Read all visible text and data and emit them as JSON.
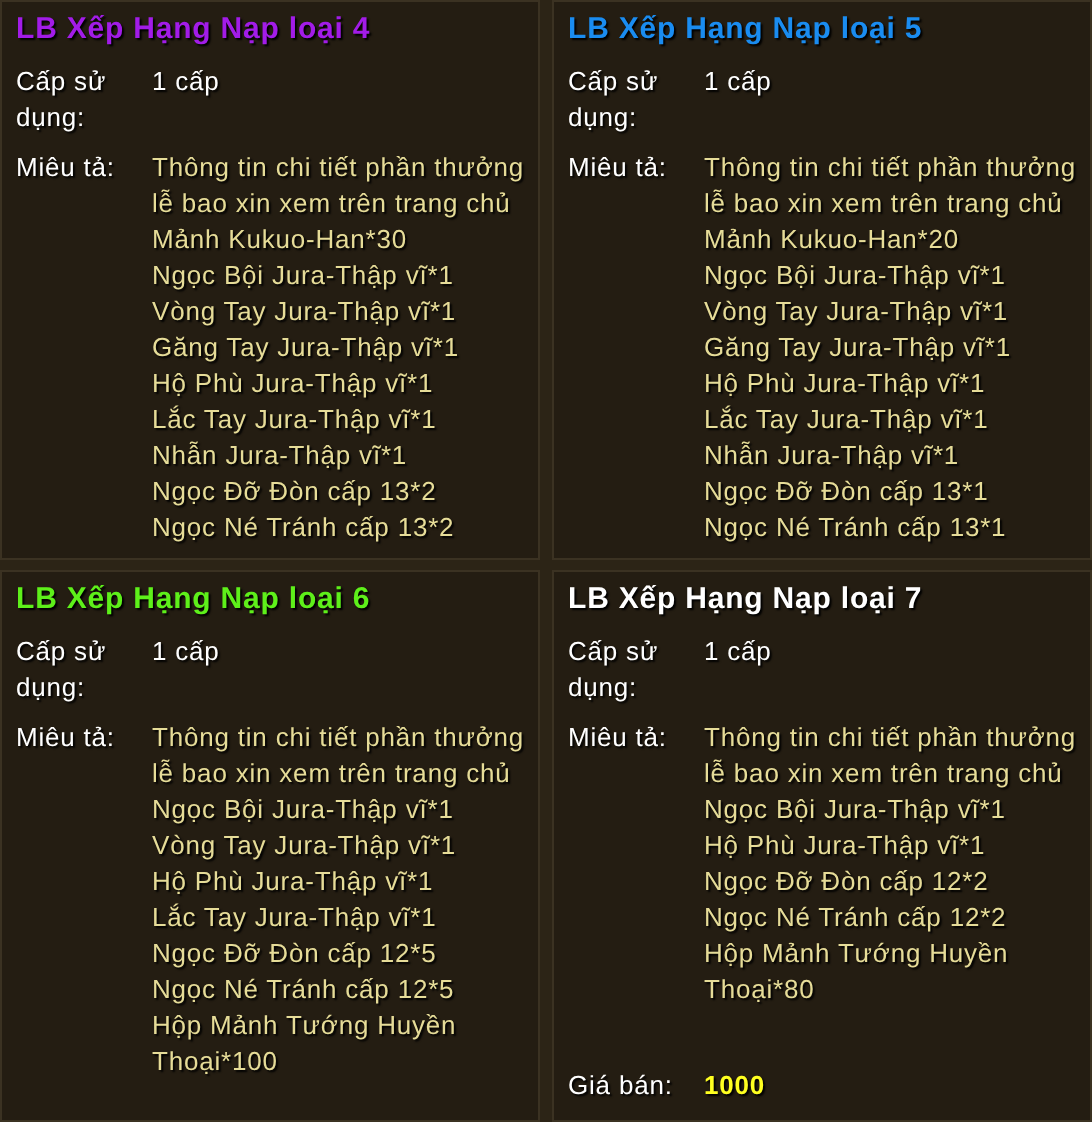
{
  "tooltips": [
    {
      "title": "LB Xếp Hạng Nạp loại 4",
      "color": "#a21ce8",
      "level_label": "Cấp sử dụng:",
      "level_value": "1 cấp",
      "desc_label": "Miêu tả:",
      "desc_lines": [
        "Thông tin chi tiết phần thưởng lễ bao xin xem trên trang chủ",
        "Mảnh Kukuo-Han*30",
        "Ngọc Bội Jura-Thập vĩ*1",
        "Vòng Tay Jura-Thập vĩ*1",
        "Găng Tay Jura-Thập vĩ*1",
        "Hộ Phù Jura-Thập vĩ*1",
        "Lắc Tay Jura-Thập vĩ*1",
        "Nhẫn Jura-Thập vĩ*1",
        "Ngọc Đỡ Đòn cấp 13*2",
        "Ngọc Né Tránh cấp 13*2"
      ]
    },
    {
      "title": "LB Xếp Hạng Nạp loại 5",
      "color": "#1a8cf0",
      "level_label": "Cấp sử dụng:",
      "level_value": "1 cấp",
      "desc_label": "Miêu tả:",
      "desc_lines": [
        "Thông tin chi tiết phần thưởng lễ bao xin xem trên trang chủ",
        "Mảnh Kukuo-Han*20",
        "Ngọc Bội Jura-Thập vĩ*1",
        "Vòng Tay Jura-Thập vĩ*1",
        "Găng Tay Jura-Thập vĩ*1",
        "Hộ Phù Jura-Thập vĩ*1",
        "Lắc Tay Jura-Thập vĩ*1",
        "Nhẫn Jura-Thập vĩ*1",
        "Ngọc Đỡ Đòn cấp 13*1",
        "Ngọc Né Tránh cấp 13*1"
      ]
    },
    {
      "title": "LB Xếp Hạng Nạp loại 6",
      "color": "#5ef01a",
      "level_label": "Cấp sử dụng:",
      "level_value": "1 cấp",
      "desc_label": "Miêu tả:",
      "desc_lines": [
        "Thông tin chi tiết phần thưởng lễ bao xin xem trên trang chủ",
        "Ngọc Bội Jura-Thập vĩ*1",
        "Vòng Tay Jura-Thập vĩ*1",
        "Hộ Phù Jura-Thập vĩ*1",
        "Lắc Tay Jura-Thập vĩ*1",
        "Ngọc Đỡ Đòn cấp 12*5",
        "Ngọc Né Tránh cấp 12*5",
        "Hộp Mảnh Tướng Huyền Thoại*100"
      ]
    },
    {
      "title": "LB Xếp Hạng Nạp loại 7",
      "color": "#ffffff",
      "level_label": "Cấp sử dụng:",
      "level_value": "1 cấp",
      "desc_label": "Miêu tả:",
      "desc_lines": [
        "Thông tin chi tiết phần thưởng lễ bao xin xem trên trang chủ",
        "Ngọc Bội Jura-Thập vĩ*1",
        "Hộ Phù Jura-Thập vĩ*1",
        "Ngọc Đỡ Đòn cấp 12*2",
        "Ngọc Né Tránh cấp 12*2",
        "Hộp Mảnh Tướng Huyền Thoại*80"
      ],
      "price_label": "Giá bán:",
      "price": "1000"
    }
  ]
}
